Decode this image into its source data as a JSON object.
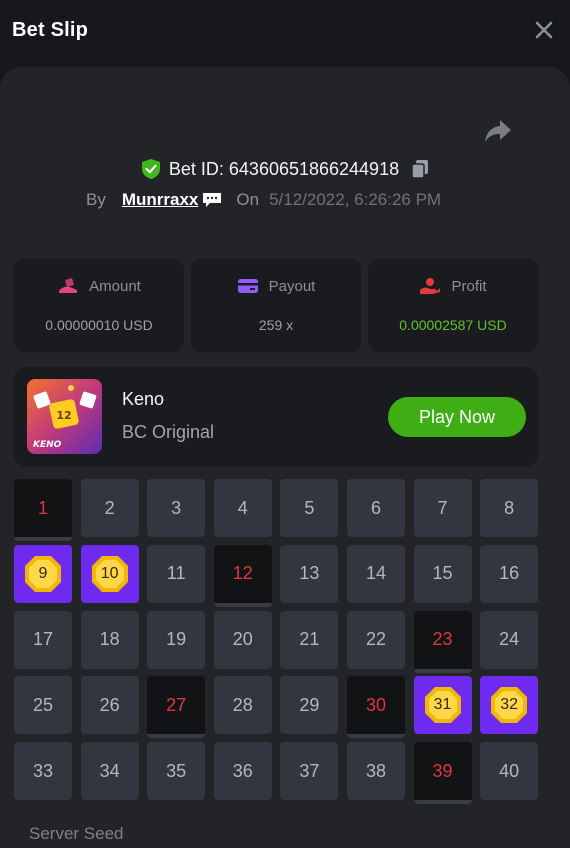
{
  "header": {
    "title": "Bet Slip",
    "close_icon": "close-icon"
  },
  "bet": {
    "id_text": "Bet ID: 64360651866244918",
    "by_label": "By",
    "username": "Munrraxx",
    "on_label": "On",
    "date": "5/12/2022, 6:26:26 PM"
  },
  "stats": [
    {
      "label": "Amount",
      "value": "0.00000010 USD",
      "icon": "amount-icon",
      "color": "#e6437c"
    },
    {
      "label": "Payout",
      "value": "259 x",
      "icon": "card-icon",
      "color": "#8d5cf6"
    },
    {
      "label": "Profit",
      "value": "0.00002587 USD",
      "icon": "profit-icon",
      "color": "#e23b3b"
    }
  ],
  "game": {
    "name": "Keno",
    "subtitle": "BC Original",
    "play_label": "Play Now",
    "thumb_number": "12",
    "thumb_label": "KENO"
  },
  "grid": {
    "numbers": [
      "1",
      "2",
      "3",
      "4",
      "5",
      "6",
      "7",
      "8",
      "9",
      "10",
      "11",
      "12",
      "13",
      "14",
      "15",
      "16",
      "17",
      "18",
      "19",
      "20",
      "21",
      "22",
      "23",
      "24",
      "25",
      "26",
      "27",
      "28",
      "29",
      "30",
      "31",
      "32",
      "33",
      "34",
      "35",
      "36",
      "37",
      "38",
      "39",
      "40"
    ],
    "states": [
      "miss",
      "none",
      "none",
      "none",
      "none",
      "none",
      "none",
      "none",
      "hit",
      "hit",
      "none",
      "miss",
      "none",
      "none",
      "none",
      "none",
      "none",
      "none",
      "none",
      "none",
      "none",
      "none",
      "miss",
      "none",
      "none",
      "none",
      "miss",
      "none",
      "none",
      "miss",
      "hit",
      "hit",
      "none",
      "none",
      "none",
      "none",
      "none",
      "none",
      "miss",
      "none"
    ]
  },
  "footer": {
    "server_seed_label": "Server Seed"
  },
  "colors": {
    "accent_green": "#3fae14",
    "hit_purple": "#6e2bef",
    "miss_red": "#e0373b"
  }
}
